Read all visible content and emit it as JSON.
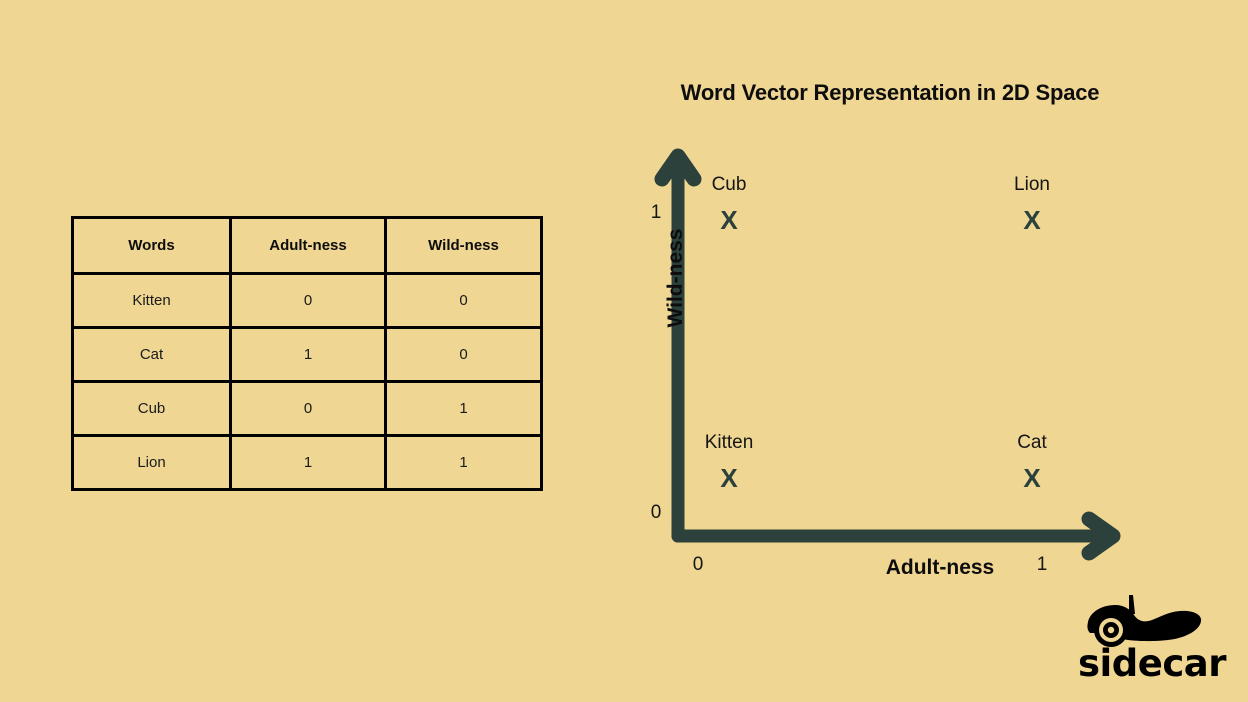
{
  "slide": {
    "background_color": "#EFD693",
    "axis_color": "#2C403C",
    "text_color": "#0d0d0d",
    "border_color": "#000000"
  },
  "table": {
    "name": "word-vector-table",
    "columns": [
      "Words",
      "Adult-ness",
      "Wild-ness"
    ],
    "rows": [
      {
        "word": "Kitten",
        "adultness": "0",
        "wildness": "0"
      },
      {
        "word": "Cat",
        "adultness": "1",
        "wildness": "0"
      },
      {
        "word": "Cub",
        "adultness": "0",
        "wildness": "1"
      },
      {
        "word": "Lion",
        "adultness": "1",
        "wildness": "1"
      }
    ]
  },
  "chart_data": {
    "type": "scatter",
    "title": "Word Vector Representation in 2D Space",
    "xlabel": "Adult-ness",
    "ylabel": "Wild-ness",
    "xlim": [
      0,
      1
    ],
    "ylim": [
      0,
      1
    ],
    "xticks": [
      "0",
      "1"
    ],
    "yticks": [
      "0",
      "1"
    ],
    "grid": false,
    "legend": false,
    "marker": "X",
    "points": [
      {
        "label": "Cub",
        "x": 0,
        "y": 1
      },
      {
        "label": "Lion",
        "x": 1,
        "y": 1
      },
      {
        "label": "Kitten",
        "x": 0,
        "y": 0
      },
      {
        "label": "Cat",
        "x": 1,
        "y": 0
      }
    ]
  },
  "logo": {
    "wordmark": "sidecar",
    "mark_icon": "sidecar-car-icon"
  }
}
